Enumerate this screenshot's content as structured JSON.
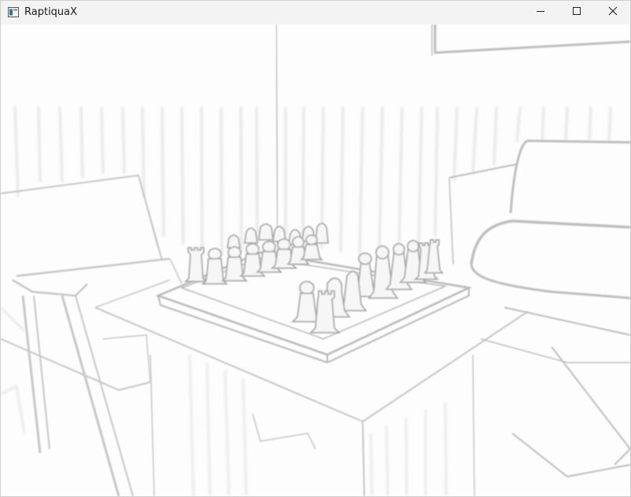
{
  "window": {
    "title": "RaptiquaX",
    "app_icon": "app-window-icon",
    "controls": {
      "minimize_icon": "minimize-icon",
      "maximize_icon": "maximize-icon",
      "close_icon": "close-icon"
    }
  },
  "viewport": {
    "render_style": "edge-detected grayscale 3D scene",
    "scene_objects": [
      "wall-panels",
      "wall-frame",
      "left-armchair",
      "right-armchair",
      "side-table",
      "chessboard",
      "white-chess-pieces"
    ]
  }
}
